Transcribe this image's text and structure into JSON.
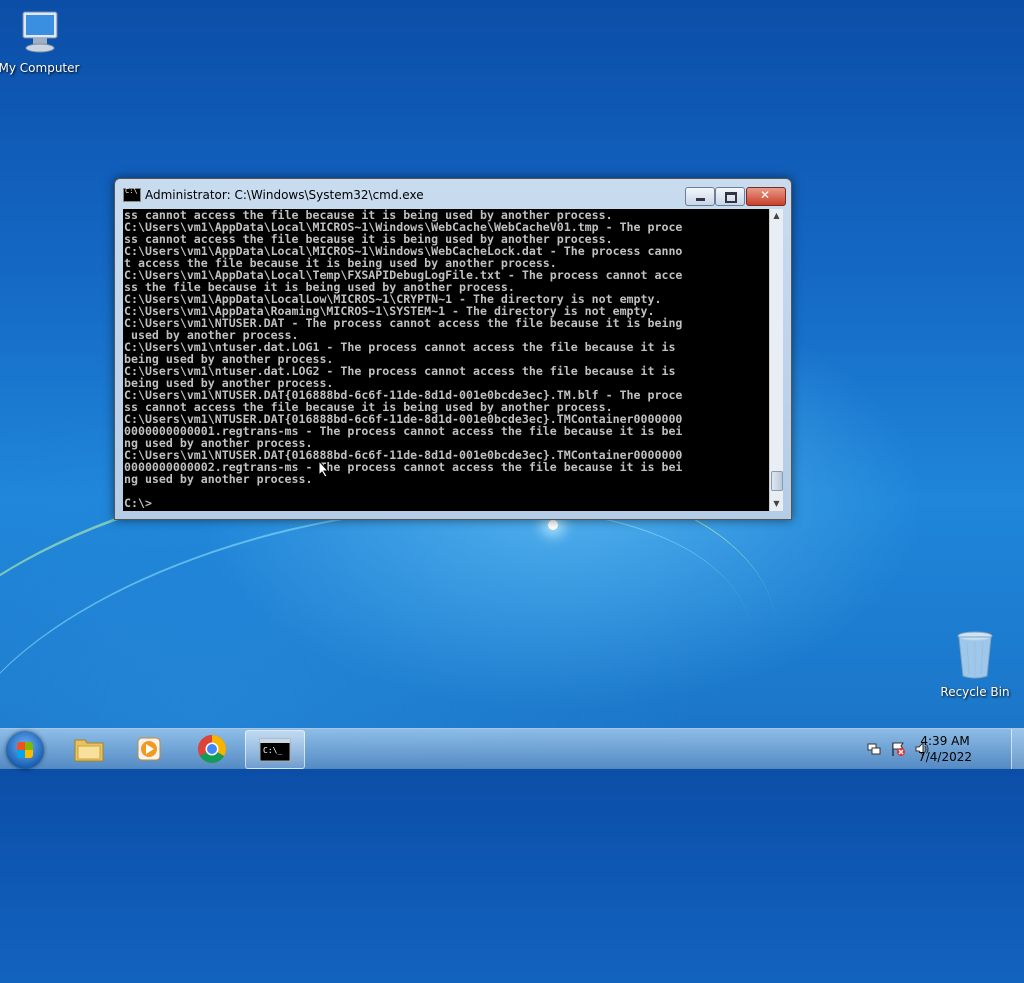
{
  "desktop": {
    "icons": [
      {
        "label": "My Computer"
      },
      {
        "label": "Recycle Bin"
      }
    ]
  },
  "window": {
    "title": "Administrator: C:\\Windows\\System32\\cmd.exe",
    "console_text": "ss cannot access the file because it is being used by another process.\nC:\\Users\\vm1\\AppData\\Local\\MICROS~1\\Windows\\WebCache\\WebCacheV01.tmp - The proce\nss cannot access the file because it is being used by another process.\nC:\\Users\\vm1\\AppData\\Local\\MICROS~1\\Windows\\WebCacheLock.dat - The process canno\nt access the file because it is being used by another process.\nC:\\Users\\vm1\\AppData\\Local\\Temp\\FXSAPIDebugLogFile.txt - The process cannot acce\nss the file because it is being used by another process.\nC:\\Users\\vm1\\AppData\\LocalLow\\MICROS~1\\CRYPTN~1 - The directory is not empty.\nC:\\Users\\vm1\\AppData\\Roaming\\MICROS~1\\SYSTEM~1 - The directory is not empty.\nC:\\Users\\vm1\\NTUSER.DAT - The process cannot access the file because it is being\n used by another process.\nC:\\Users\\vm1\\ntuser.dat.LOG1 - The process cannot access the file because it is\nbeing used by another process.\nC:\\Users\\vm1\\ntuser.dat.LOG2 - The process cannot access the file because it is\nbeing used by another process.\nC:\\Users\\vm1\\NTUSER.DAT{016888bd-6c6f-11de-8d1d-001e0bcde3ec}.TM.blf - The proce\nss cannot access the file because it is being used by another process.\nC:\\Users\\vm1\\NTUSER.DAT{016888bd-6c6f-11de-8d1d-001e0bcde3ec}.TMContainer0000000\n0000000000001.regtrans-ms - The process cannot access the file because it is bei\nng used by another process.\nC:\\Users\\vm1\\NTUSER.DAT{016888bd-6c6f-11de-8d1d-001e0bcde3ec}.TMContainer0000000\n0000000000002.regtrans-ms - The process cannot access the file because it is bei\nng used by another process.\n\nC:\\>"
  },
  "taskbar": {
    "pinned": [
      {
        "icon": "folder-icon"
      },
      {
        "icon": "media-player-icon"
      },
      {
        "icon": "chrome-icon"
      },
      {
        "icon": "cmd-icon"
      }
    ],
    "clock": {
      "time": "4:39 AM",
      "date": "7/4/2022"
    }
  }
}
